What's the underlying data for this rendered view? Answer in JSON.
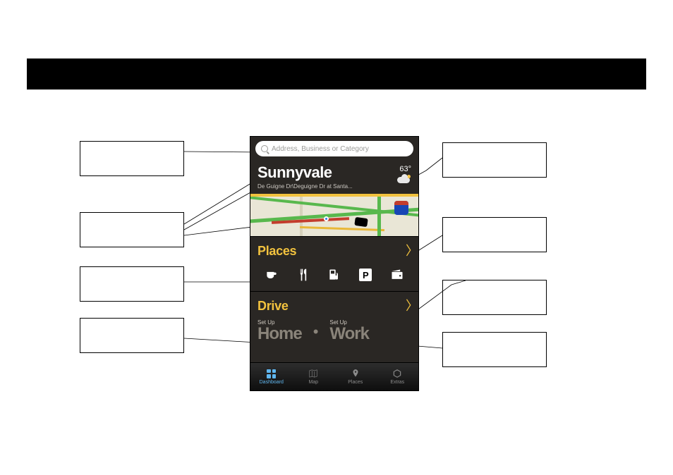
{
  "black_band": true,
  "search": {
    "placeholder": "Address, Business or Category"
  },
  "city": {
    "name": "Sunnyvale",
    "subaddress": "De Guigne Dr\\Deguigne Dr at Santa..."
  },
  "weather": {
    "temp": "63°"
  },
  "places": {
    "label": "Places",
    "icons": [
      {
        "name": "coffee-icon"
      },
      {
        "name": "food-icon"
      },
      {
        "name": "gas-icon"
      },
      {
        "name": "parking-icon",
        "letter": "P"
      },
      {
        "name": "wallet-icon"
      }
    ]
  },
  "drive": {
    "label": "Drive",
    "home": {
      "setup": "Set Up",
      "label": "Home"
    },
    "work": {
      "setup": "Set Up",
      "label": "Work"
    }
  },
  "tabs": [
    {
      "name": "dashboard",
      "label": "Dashboard",
      "active": true
    },
    {
      "name": "map",
      "label": "Map",
      "active": false
    },
    {
      "name": "places",
      "label": "Places",
      "active": false
    },
    {
      "name": "extras",
      "label": "Extras",
      "active": false
    }
  ],
  "callouts": {
    "left": [
      {
        "id": "c1"
      },
      {
        "id": "c2"
      },
      {
        "id": "c3"
      },
      {
        "id": "c4"
      }
    ],
    "right": [
      {
        "id": "c5"
      },
      {
        "id": "c6"
      },
      {
        "id": "c7"
      },
      {
        "id": "c8"
      }
    ]
  }
}
